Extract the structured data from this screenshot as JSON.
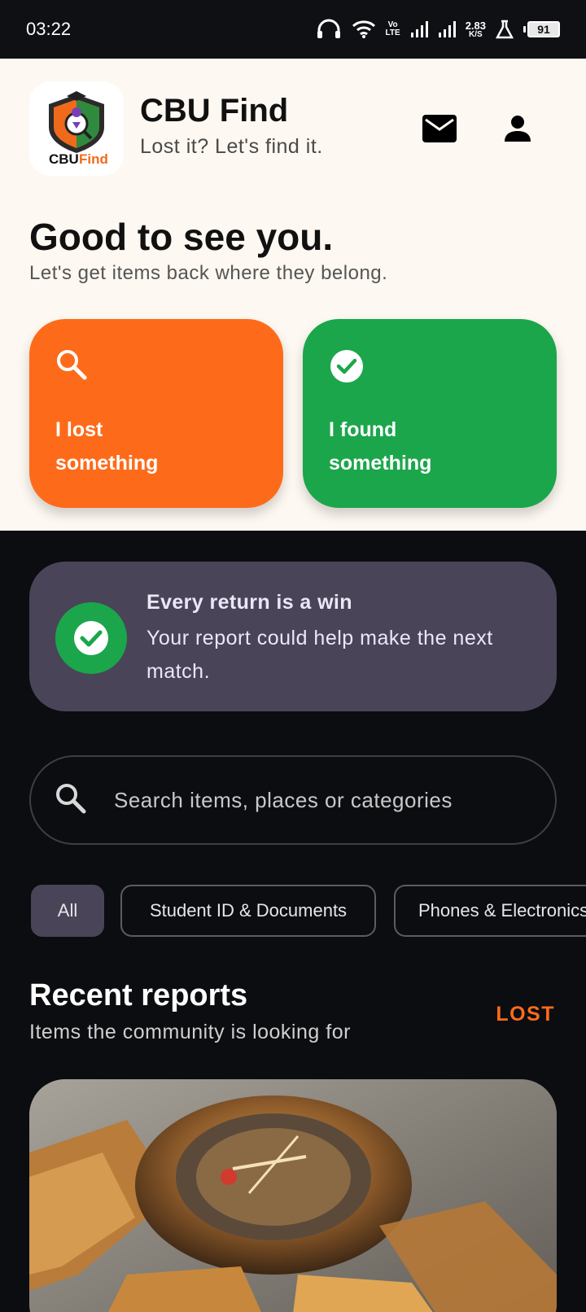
{
  "status_bar": {
    "time": "03:22",
    "volte_top": "Vo",
    "volte_bottom": "LTE",
    "net_speed_top": "2.83",
    "net_speed_bottom": "K/S",
    "battery": "91"
  },
  "header": {
    "app_title": "CBU Find",
    "tagline": "Lost it? Let's find it.",
    "logo_text_1": "CBU",
    "logo_text_2": "Find",
    "icons": [
      "mail-icon",
      "account-icon"
    ]
  },
  "greeting": {
    "title": "Good to see you.",
    "subtitle": "Let's get items back where they belong."
  },
  "actions": {
    "lost_line1": "I lost",
    "lost_line2": "something",
    "found_line1": "I found",
    "found_line2": "something",
    "lost_color": "#fd6b1a",
    "found_color": "#1ba64b"
  },
  "banner": {
    "title": "Every return is a win",
    "text": "Your report could help make the next match."
  },
  "search": {
    "placeholder": "Search items, places or categories"
  },
  "chips": [
    "All",
    "Student ID & Documents",
    "Phones & Electronics"
  ],
  "recent": {
    "title": "Recent reports",
    "subtitle": "Items the community is looking for",
    "tag": "LOST"
  }
}
